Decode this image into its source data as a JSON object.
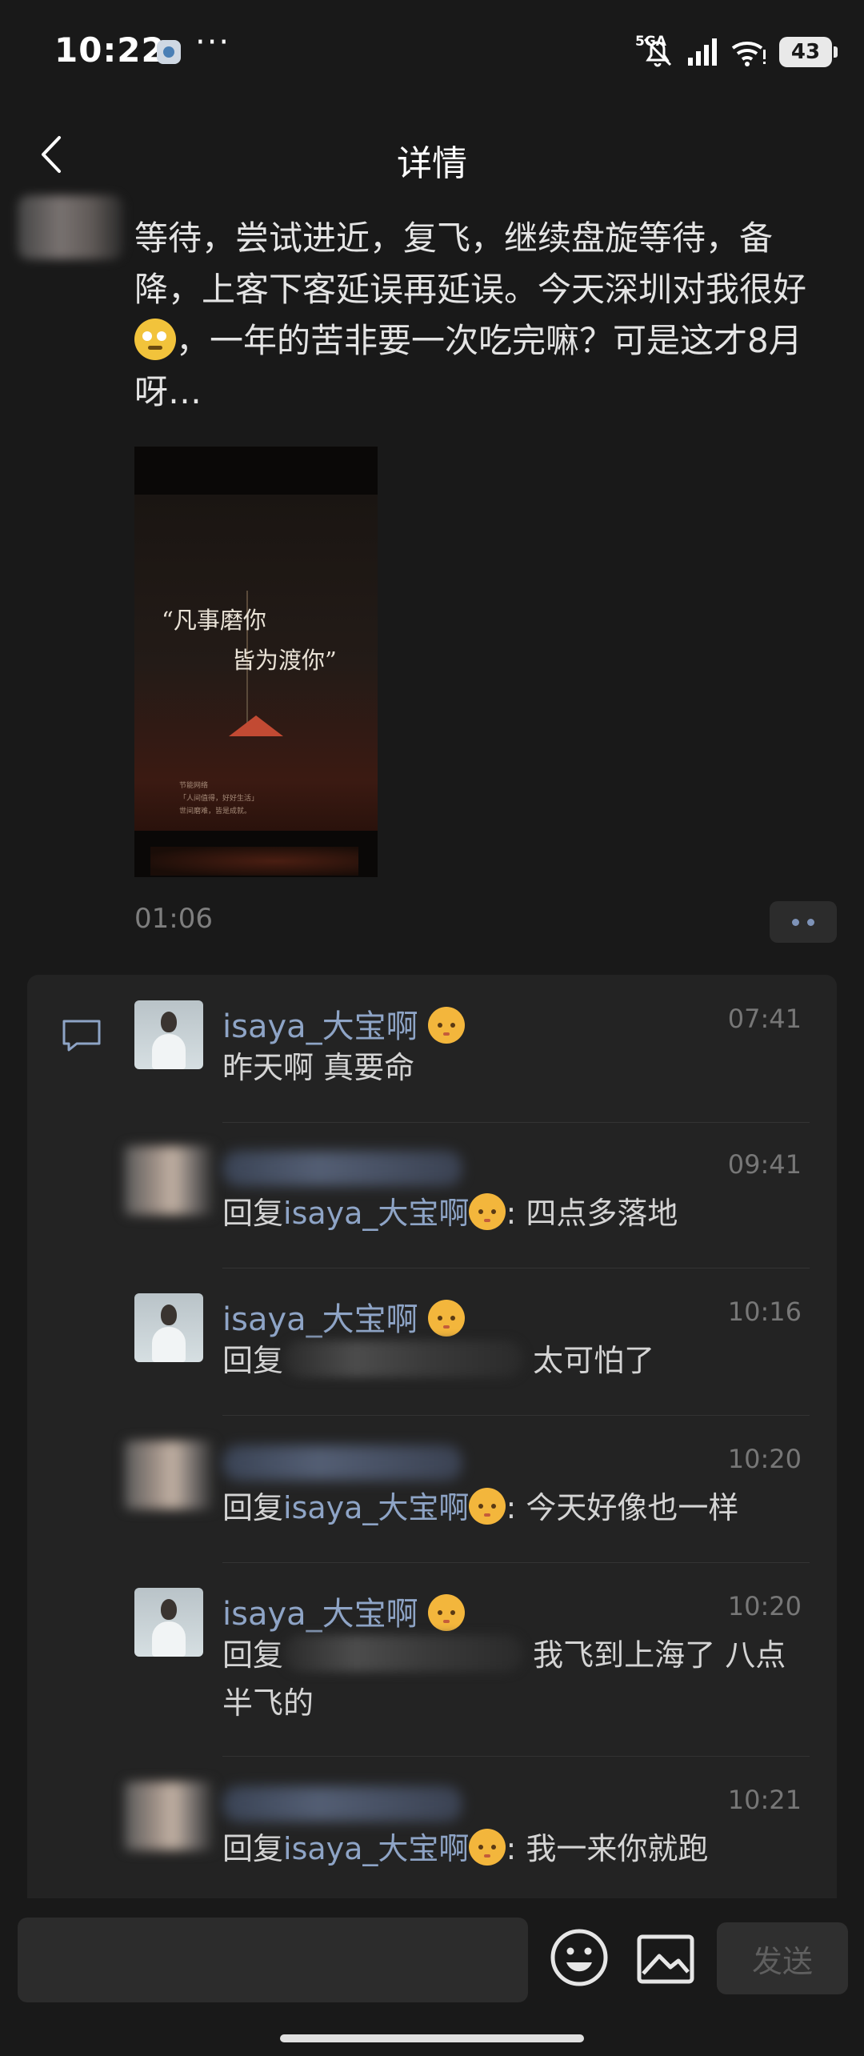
{
  "status_bar": {
    "time": "10:22",
    "more": "···",
    "network": "5GA",
    "battery": "43"
  },
  "nav": {
    "title": "详情"
  },
  "post": {
    "text_before_emoji": "等待，尝试进近，复飞，继续盘旋等待，备降，上客下客延误再延误。今天深圳对我很好",
    "text_after_emoji": "，一年的苦非要一次吃完嘛？可是这才8月呀…",
    "video": {
      "quote_line1": "“凡事磨你",
      "quote_line2": "皆为渡你”",
      "caption_line1": "节能网络",
      "caption_line2": "「人间值得，好好生活」",
      "caption_line3": "世间磨难，皆是成就。"
    },
    "time": "01:06"
  },
  "comments": [
    {
      "name": "isaya_大宝啊",
      "time": "07:41",
      "text": "昨天啊 真要命"
    },
    {
      "name": "",
      "time": "09:41",
      "prefix": "回复",
      "mention": "isaya_大宝啊",
      "text": ": 四点多落地"
    },
    {
      "name": "isaya_大宝啊",
      "time": "10:16",
      "prefix": "回复",
      "text": "太可怕了"
    },
    {
      "name": "",
      "time": "10:20",
      "prefix": "回复",
      "mention": "isaya_大宝啊",
      "text": ": 今天好像也一样"
    },
    {
      "name": "isaya_大宝啊",
      "time": "10:20",
      "prefix": "回复",
      "text": "我飞到上海了 八点半飞的"
    },
    {
      "name": "",
      "time": "10:21",
      "prefix": "回复",
      "mention": "isaya_大宝啊",
      "text": ": 我一来你就跑"
    }
  ],
  "input": {
    "placeholder": "",
    "send_label": "发送"
  }
}
